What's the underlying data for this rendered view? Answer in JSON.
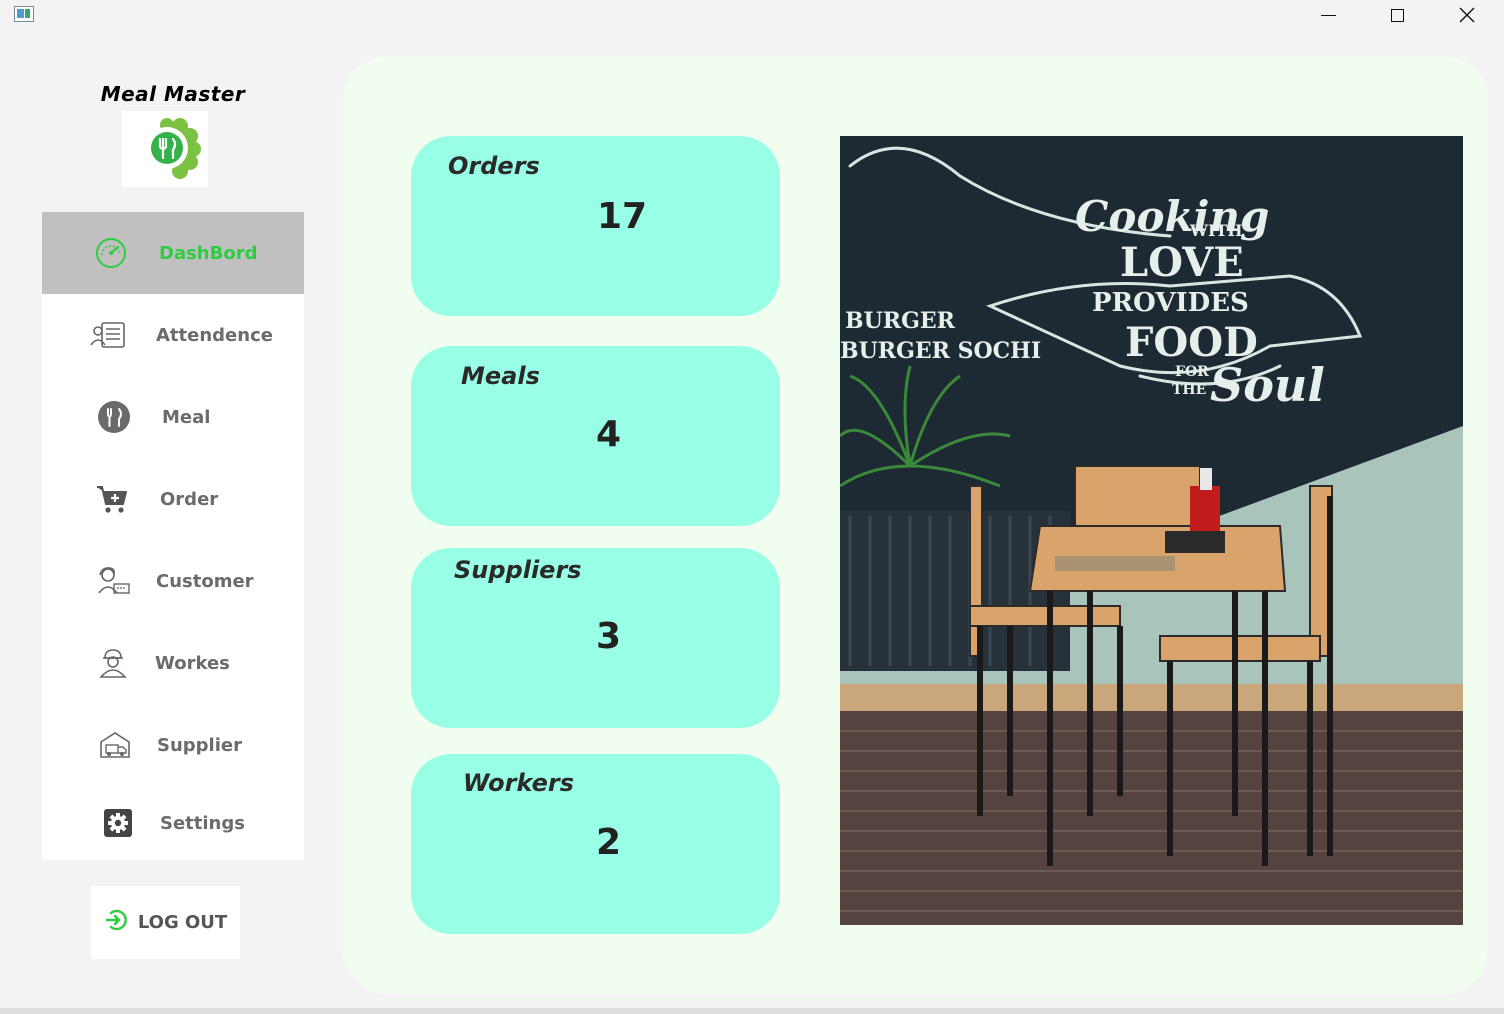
{
  "app": {
    "title": "Meal Master",
    "accent_color": "#2ecc40",
    "card_color": "#98ffe6",
    "main_bg": "#f0fdef"
  },
  "window_controls": {
    "icons": [
      "minimize-icon",
      "maximize-icon",
      "close-icon"
    ]
  },
  "sidebar": {
    "items": [
      {
        "label": "DashBord",
        "icon": "speedometer-icon",
        "active": true
      },
      {
        "label": "Attendence",
        "icon": "attendance-icon",
        "active": false
      },
      {
        "label": "Meal",
        "icon": "fork-knife-icon",
        "active": false
      },
      {
        "label": "Order",
        "icon": "cart-icon",
        "active": false
      },
      {
        "label": "Customer",
        "icon": "customer-icon",
        "active": false
      },
      {
        "label": "Workes",
        "icon": "worker-icon",
        "active": false
      },
      {
        "label": "Supplier",
        "icon": "delivery-truck-icon",
        "active": false
      },
      {
        "label": "Settings",
        "icon": "gear-icon",
        "active": false
      }
    ]
  },
  "logout": {
    "label": "LOG OUT",
    "icon": "logout-icon"
  },
  "cards": [
    {
      "label": "Orders",
      "value": "17"
    },
    {
      "label": "Meals",
      "value": "4"
    },
    {
      "label": "Suppliers",
      "value": "3"
    },
    {
      "label": "Workers",
      "value": "2"
    }
  ],
  "photo": {
    "chalk_text": [
      "Cooking",
      "WITH",
      "LOVE",
      "PROVIDES",
      "FOOD",
      "FOR",
      "THE",
      "Soul",
      "BURGER",
      "BURGER SOCHI"
    ]
  }
}
